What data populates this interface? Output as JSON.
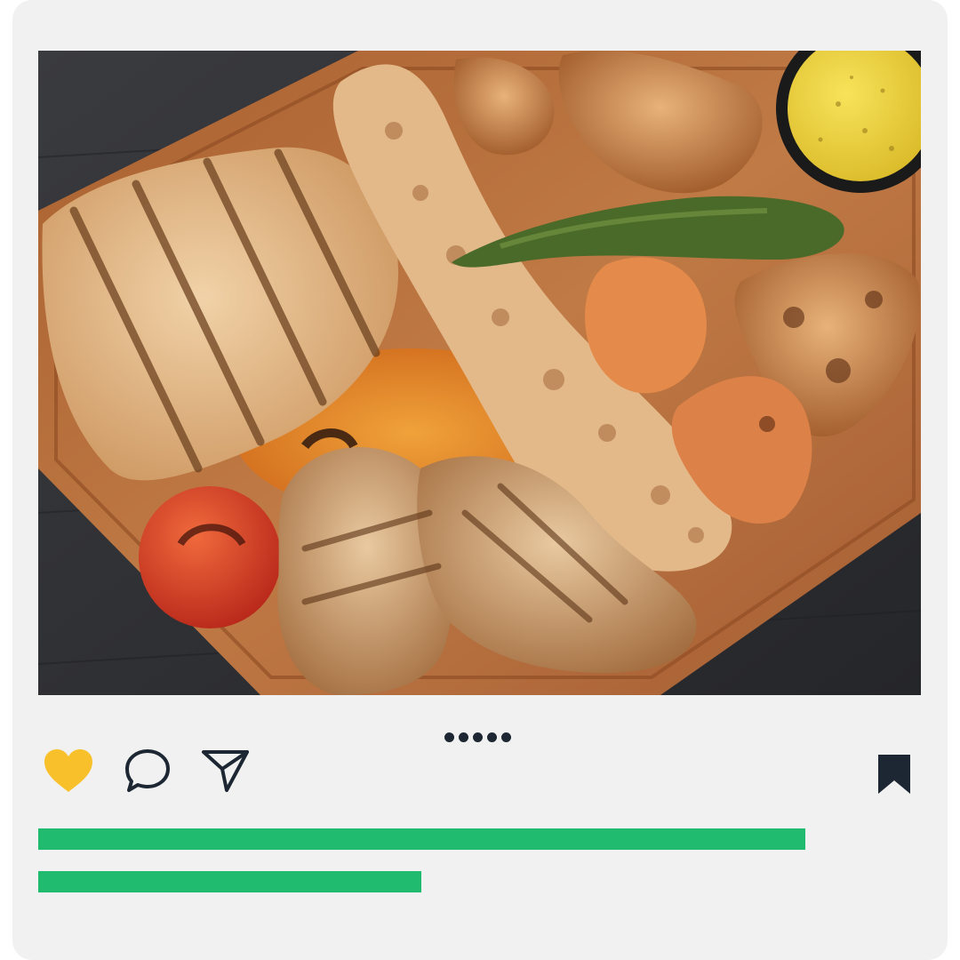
{
  "post": {
    "photo_subject": "grilled-chicken-platter",
    "carousel": {
      "page_count": 5,
      "current_page": 1
    },
    "actions": {
      "like": {
        "icon": "heart-icon",
        "state": "liked"
      },
      "comment": {
        "icon": "comment-bubble-icon"
      },
      "share": {
        "icon": "paper-plane-icon"
      },
      "save": {
        "icon": "bookmark-icon",
        "state": "saved"
      }
    },
    "caption_placeholder_lines": [
      {
        "fraction_of_width": 0.87
      },
      {
        "fraction_of_width": 0.43
      }
    ]
  },
  "colors": {
    "card_background": "#f1f1f1",
    "like_color": "#f8c12c",
    "icon_color": "#1c2733",
    "caption_bar": "#20bb6f",
    "table": "#2e2f33",
    "board": "#b2683a"
  }
}
